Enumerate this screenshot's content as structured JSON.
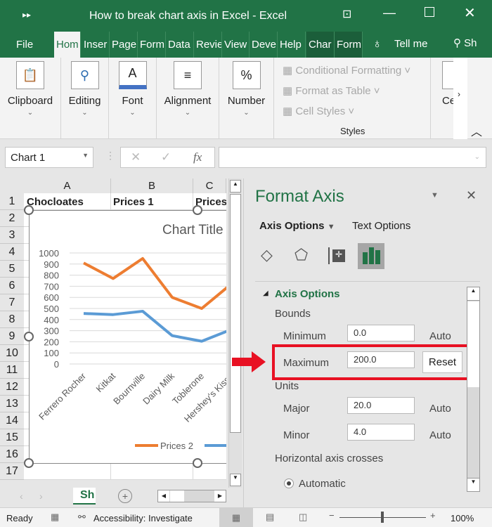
{
  "window": {
    "title": "How to break chart axis in Excel  -  Excel"
  },
  "tabs": [
    "File",
    "Hom",
    "Inser",
    "Page",
    "Form",
    "Data",
    "Revie",
    "View",
    "Deve",
    "Help",
    "Char",
    "Form"
  ],
  "tell_me": "Tell me",
  "share": "Sh",
  "ribbon": {
    "groups": [
      "Clipboard",
      "Editing",
      "Font",
      "Alignment",
      "Number"
    ],
    "styles": [
      "Conditional Formatting",
      "Format as Table",
      "Cell Styles"
    ],
    "styles_label": "Styles",
    "cells": "Ce"
  },
  "formula_bar": {
    "name_box": "Chart 1",
    "fx": "fx",
    "value": ""
  },
  "sheet": {
    "columns": [
      "A",
      "B",
      "C"
    ],
    "rows": [
      "1",
      "2",
      "3",
      "4",
      "5",
      "6",
      "7",
      "8",
      "9",
      "10",
      "11",
      "12",
      "13",
      "14",
      "15",
      "16",
      "17"
    ],
    "row1": [
      "Chocloates",
      "Prices 1",
      "Prices"
    ],
    "tab": "Sh"
  },
  "chart_data": {
    "type": "line",
    "title": "Chart Title",
    "categories": [
      "Ferrero Rocher",
      "Kitkat",
      "Bournville",
      "Dairy Milk",
      "Toblerone",
      "Hershey's Kisse"
    ],
    "yticks": [
      "0",
      "100",
      "200",
      "300",
      "400",
      "500",
      "600",
      "700",
      "800",
      "900",
      "1000"
    ],
    "ylim": [
      0,
      1000
    ],
    "series": [
      {
        "name": "Prices 2",
        "color": "#ed7d31",
        "values": [
          910,
          770,
          950,
          600,
          500,
          720
        ]
      },
      {
        "color": "#5b9bd5",
        "values": [
          455,
          445,
          475,
          255,
          205,
          310
        ]
      }
    ],
    "legend": "bottom",
    "grid": true
  },
  "pane": {
    "title": "Format Axis",
    "tab1": "Axis Options",
    "tab2": "Text Options",
    "section": "Axis Options",
    "bounds": "Bounds",
    "minimum_label": "Minimum",
    "minimum": "0.0",
    "minimum_state": "Auto",
    "maximum_label": "Maximum",
    "maximum": "200.0",
    "reset": "Reset",
    "units": "Units",
    "major_label": "Major",
    "major": "20.0",
    "major_state": "Auto",
    "minor_label": "Minor",
    "minor": "4.0",
    "minor_state": "Auto",
    "crosses": "Horizontal axis crosses",
    "automatic": "Automatic",
    "highlight_color": "#e81123"
  },
  "status": {
    "ready": "Ready",
    "accessibility": "Accessibility: Investigate",
    "zoom": "100%"
  }
}
